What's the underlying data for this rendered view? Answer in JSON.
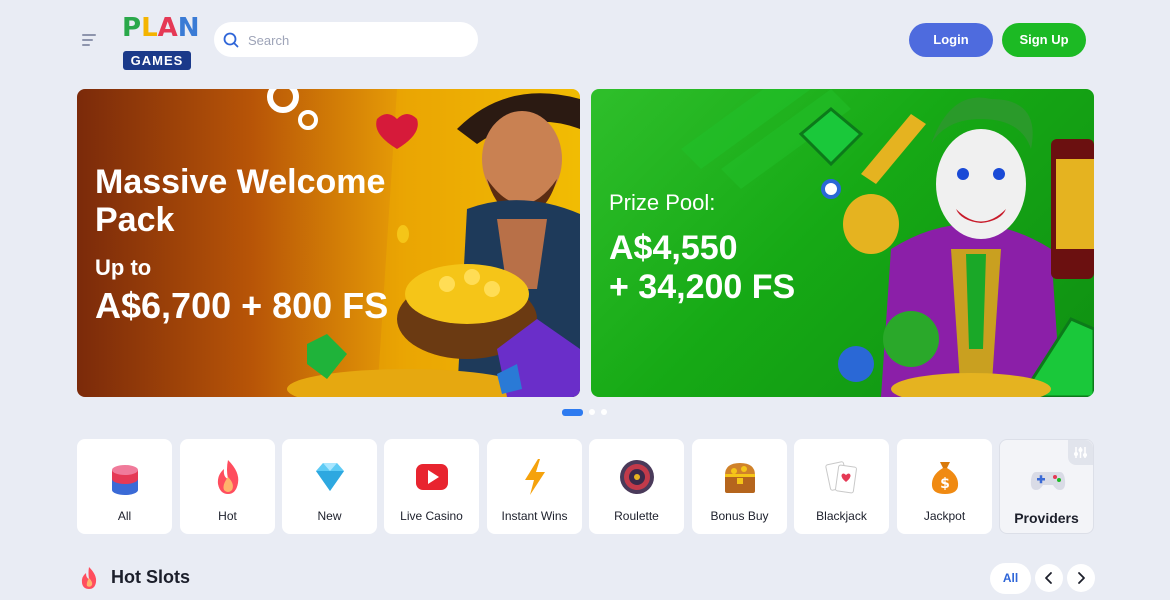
{
  "header": {
    "logo_top": "PLAN",
    "logo_bottom": "GAMES",
    "search_placeholder": "Search",
    "login_label": "Login",
    "signup_label": "Sign Up"
  },
  "banners": [
    {
      "title": "Massive Welcome Pack",
      "subtitle": "Up to",
      "amount": "A$6,700 + 800 FS"
    },
    {
      "label": "Prize Pool:",
      "amount_line1": "A$4,550",
      "amount_line2": "+ 34,200 FS"
    }
  ],
  "carousel": {
    "total": 3,
    "active": 1
  },
  "categories": [
    {
      "label": "All",
      "icon": "chips-icon"
    },
    {
      "label": "Hot",
      "icon": "flame-icon"
    },
    {
      "label": "New",
      "icon": "diamond-icon"
    },
    {
      "label": "Live Casino",
      "icon": "play-icon"
    },
    {
      "label": "Instant Wins",
      "icon": "lightning-icon"
    },
    {
      "label": "Roulette",
      "icon": "roulette-icon"
    },
    {
      "label": "Bonus Buy",
      "icon": "treasure-chest-icon"
    },
    {
      "label": "Blackjack",
      "icon": "cards-icon"
    },
    {
      "label": "Jackpot",
      "icon": "money-bag-icon"
    },
    {
      "label": "Providers",
      "icon": "gamepad-icon"
    }
  ],
  "hot_slots": {
    "title": "Hot Slots",
    "all_label": "All"
  },
  "colors": {
    "background": "#e9ecf4",
    "login": "#4e6bde",
    "signup": "#1cba24",
    "accent": "#2e7bf0"
  }
}
